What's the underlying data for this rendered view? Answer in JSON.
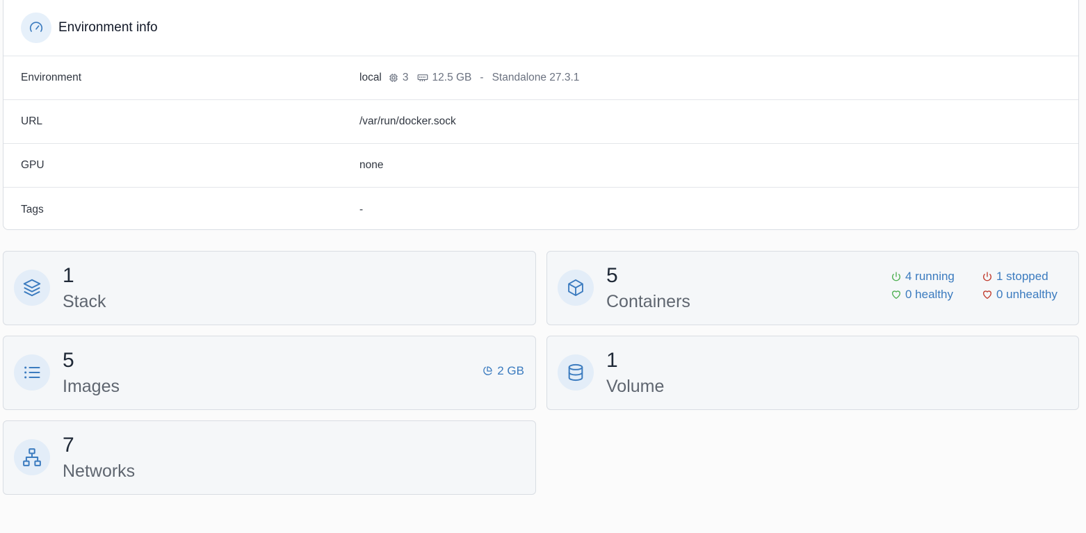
{
  "environment_info": {
    "title": "Environment info",
    "rows": {
      "environment": {
        "label": "Environment",
        "name": "local",
        "cpu": "3",
        "memory": "12.5 GB",
        "separator": "-",
        "engine": "Standalone 27.3.1"
      },
      "url": {
        "label": "URL",
        "value": "/var/run/docker.sock"
      },
      "gpu": {
        "label": "GPU",
        "value": "none"
      },
      "tags": {
        "label": "Tags",
        "value": "-"
      }
    }
  },
  "cards": {
    "stack": {
      "count": "1",
      "label": "Stack",
      "icon": "layers-icon"
    },
    "containers": {
      "count": "5",
      "label": "Containers",
      "icon": "box-icon",
      "running": "4 running",
      "stopped": "1 stopped",
      "healthy": "0 healthy",
      "unhealthy": "0 unhealthy"
    },
    "images": {
      "count": "5",
      "label": "Images",
      "icon": "list-icon",
      "size": "2 GB"
    },
    "volume": {
      "count": "1",
      "label": "Volume",
      "icon": "database-icon"
    },
    "networks": {
      "count": "7",
      "label": "Networks",
      "icon": "network-icon"
    }
  },
  "colors": {
    "accent": "#3b7bbf",
    "running": "#4caf50",
    "stopped": "#c0392b",
    "icon_bg": "#e3edf8"
  }
}
